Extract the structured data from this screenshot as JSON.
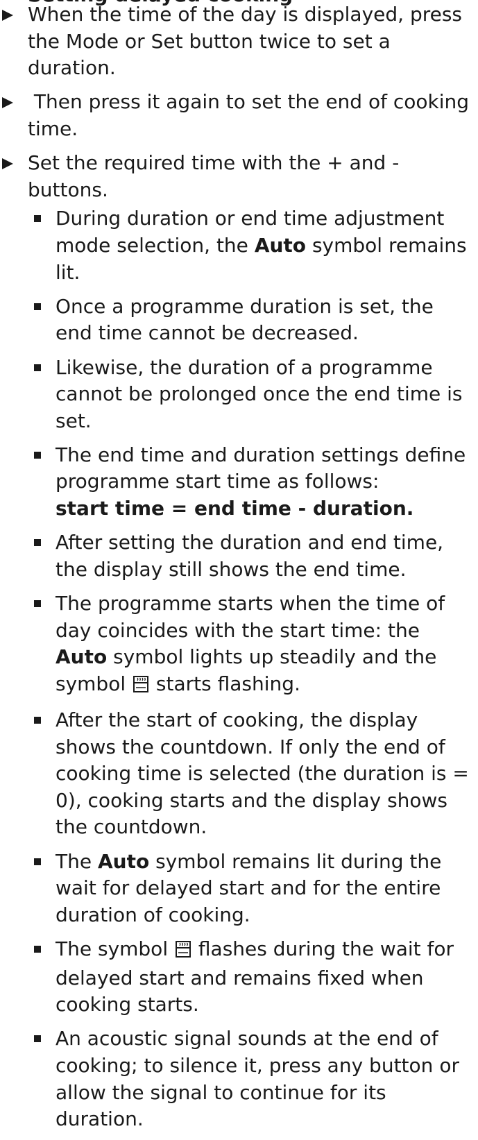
{
  "heading_partial": "Setting delayed cooking",
  "steps": [
    {
      "text": "When the time of the day is displayed, press the Mode or Set button twice to set a duration."
    },
    {
      "text": " Then press it again to set the end of cooking time."
    },
    {
      "text": "Set the required time with the + and - buttons."
    }
  ],
  "notes": {
    "n1": {
      "a": "During duration or end time adjustment mode selection, the ",
      "b": "Auto",
      "c": " symbol remains lit."
    },
    "n2": {
      "text": "Once a programme duration is set, the end time cannot be decreased."
    },
    "n3": {
      "text": "Likewise, the duration of a programme cannot be prolonged once the end time is set."
    },
    "n4": {
      "text": "The end time and duration settings define programme start time as follows:",
      "formula": "start time = end time - duration."
    },
    "n5": {
      "text": "After setting the duration and end time, the display still shows the end time."
    },
    "n6": {
      "a": "The programme starts when the time of day coincides with the start time: the ",
      "b": "Auto",
      "c": " symbol lights up steadily and the symbol ",
      "d": " starts flashing."
    },
    "n7": {
      "text": "After the start of cooking, the display shows the countdown. If only the end of cooking time is selected (the duration is = 0), cooking starts and the display shows the countdown."
    },
    "n8": {
      "a": "The ",
      "b": "Auto",
      "c": " symbol remains lit during the wait for delayed start and for the entire duration of cooking."
    },
    "n9": {
      "a": "The symbol ",
      "b": " flashes during the wait for delayed start and remains fixed when cooking starts."
    },
    "n10": {
      "text": "An acoustic signal sounds at the end of cooking; to silence it, press any button or allow the signal to continue for its duration."
    }
  },
  "icons": {
    "oven": "oven-heat-icon"
  },
  "colors": {
    "text": "#1a1a1a",
    "background": "#ffffff"
  }
}
